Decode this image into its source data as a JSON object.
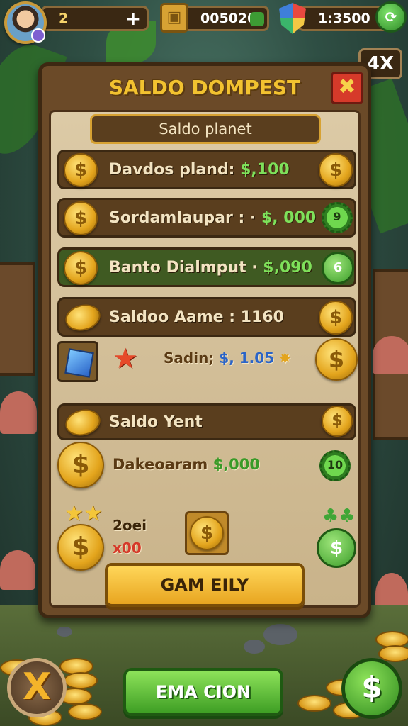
{
  "hud": {
    "lives": "2",
    "plus": "+",
    "gold": "005020",
    "gems": "1:3500"
  },
  "speed_label": "4X",
  "panel": {
    "title": "SALDO DOMPEST",
    "close": "✖",
    "subtitle": "Saldo planet",
    "rows": [
      {
        "label": "Davdos pland:",
        "amount": "$,100",
        "right_icon": "gold-coin"
      },
      {
        "label": "Sordamlaupar : ·",
        "amount": "$, 000",
        "right_badge": "9"
      },
      {
        "label": "Banto Dialmput ·",
        "amount": "$,090",
        "right_badge": "6"
      },
      {
        "label": "Saldoo Aame : 1160",
        "amount": "",
        "right_icon": "gold-coin"
      }
    ],
    "cube_row": {
      "label": "Sadin;",
      "amount": "$, 1.05",
      "suffix": "✸"
    },
    "section_header": "Saldo Yent",
    "bonus_row": {
      "label": "Dakeoaram",
      "amount": "$,000",
      "badge": "10"
    },
    "reward": {
      "title": "2oei",
      "value": "x00"
    },
    "game_button": "GAM  EILY"
  },
  "bottom": {
    "x_button": "X",
    "action_button": "EMA CION",
    "dollar_button": "$"
  },
  "colors": {
    "panel_wood": "#6b4a28",
    "parchment": "#dccaa6",
    "title_gold": "#f2c230",
    "amount_green": "#7ee05a",
    "action_green": "#3e9e24"
  }
}
